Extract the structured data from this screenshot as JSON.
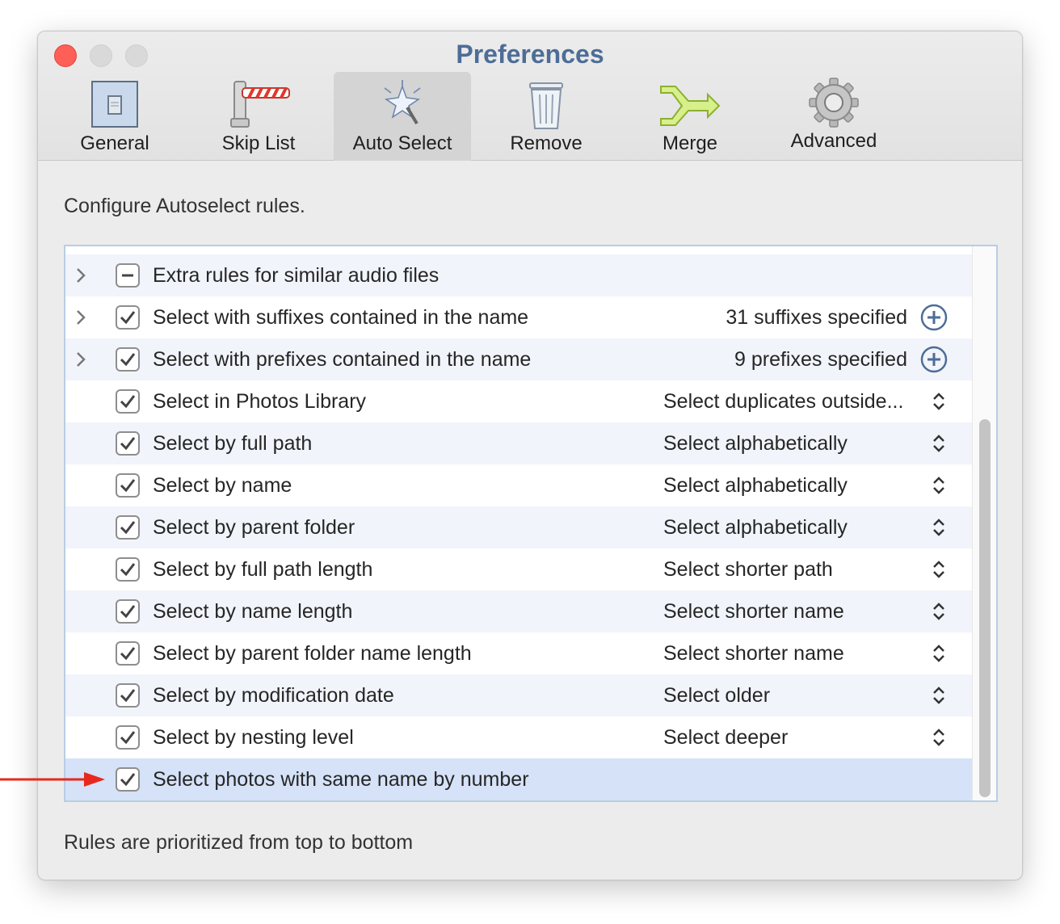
{
  "window": {
    "title": "Preferences"
  },
  "toolbar": {
    "tabs": [
      {
        "label": "General",
        "icon": "switch-icon"
      },
      {
        "label": "Skip List",
        "icon": "barrier-icon"
      },
      {
        "label": "Auto Select",
        "icon": "magic-wand-icon",
        "active": true
      },
      {
        "label": "Remove",
        "icon": "trash-icon"
      },
      {
        "label": "Merge",
        "icon": "merge-arrow-icon"
      },
      {
        "label": "Advanced",
        "icon": "gear-icon"
      }
    ]
  },
  "main": {
    "description": "Configure Autoselect rules.",
    "footer": "Rules are prioritized from top to bottom",
    "rules": [
      {
        "label": "Extra rules for similar audio files",
        "state": "mixed",
        "expandable": true
      },
      {
        "label": "Select with suffixes contained in the name",
        "state": "checked",
        "expandable": true,
        "value": "31 suffixes specified",
        "control": "add"
      },
      {
        "label": "Select with prefixes contained in the name",
        "state": "checked",
        "expandable": true,
        "value": "9 prefixes specified",
        "control": "add"
      },
      {
        "label": "Select in Photos Library",
        "state": "checked",
        "value": "Select duplicates outside...",
        "control": "popup"
      },
      {
        "label": "Select by full path",
        "state": "checked",
        "value": "Select alphabetically",
        "control": "popup"
      },
      {
        "label": "Select by name",
        "state": "checked",
        "value": "Select alphabetically",
        "control": "popup"
      },
      {
        "label": "Select by parent folder",
        "state": "checked",
        "value": "Select alphabetically",
        "control": "popup"
      },
      {
        "label": "Select by full path length",
        "state": "checked",
        "value": "Select shorter path",
        "control": "popup"
      },
      {
        "label": "Select by name length",
        "state": "checked",
        "value": "Select shorter name",
        "control": "popup"
      },
      {
        "label": "Select by parent folder name length",
        "state": "checked",
        "value": "Select shorter name",
        "control": "popup"
      },
      {
        "label": "Select by modification date",
        "state": "checked",
        "value": "Select older",
        "control": "popup"
      },
      {
        "label": "Select by nesting level",
        "state": "checked",
        "value": "Select deeper",
        "control": "popup"
      },
      {
        "label": "Select photos with same name by number",
        "state": "checked",
        "selected": true
      }
    ]
  },
  "colors": {
    "title": "#4d6d97",
    "selection": "#d5e2f8",
    "annotation_arrow": "#e8281e"
  }
}
